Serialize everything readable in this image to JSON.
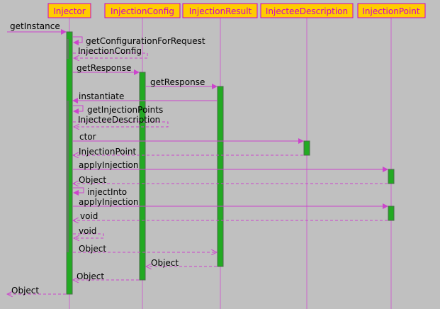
{
  "participants": [
    {
      "id": "injector",
      "name": "Injector"
    },
    {
      "id": "config",
      "name": "InjectionConfig"
    },
    {
      "id": "result",
      "name": "InjectionResult"
    },
    {
      "id": "desc",
      "name": "InjecteeDescription"
    },
    {
      "id": "point",
      "name": "InjectionPoint"
    }
  ],
  "messages": [
    {
      "id": "m1",
      "label": "getInstance"
    },
    {
      "id": "m2",
      "label": "getConfigurationForRequest"
    },
    {
      "id": "m3",
      "label": "InjectionConfig"
    },
    {
      "id": "m4",
      "label": "getResponse"
    },
    {
      "id": "m5",
      "label": "getResponse"
    },
    {
      "id": "m6",
      "label": "instantiate"
    },
    {
      "id": "m7",
      "label": "getInjectionPoints"
    },
    {
      "id": "m8",
      "label": "InjecteeDescription"
    },
    {
      "id": "m9",
      "label": "ctor"
    },
    {
      "id": "m10",
      "label": "InjectionPoint"
    },
    {
      "id": "m11",
      "label": "applyInjection"
    },
    {
      "id": "m12",
      "label": "Object"
    },
    {
      "id": "m13",
      "label": "injectInto"
    },
    {
      "id": "m14",
      "label": "applyInjection"
    },
    {
      "id": "m15",
      "label": "void"
    },
    {
      "id": "m16",
      "label": "void"
    },
    {
      "id": "m17",
      "label": "Object"
    },
    {
      "id": "m18",
      "label": "Object"
    },
    {
      "id": "m19",
      "label": "Object"
    },
    {
      "id": "m20",
      "label": "Object"
    }
  ]
}
